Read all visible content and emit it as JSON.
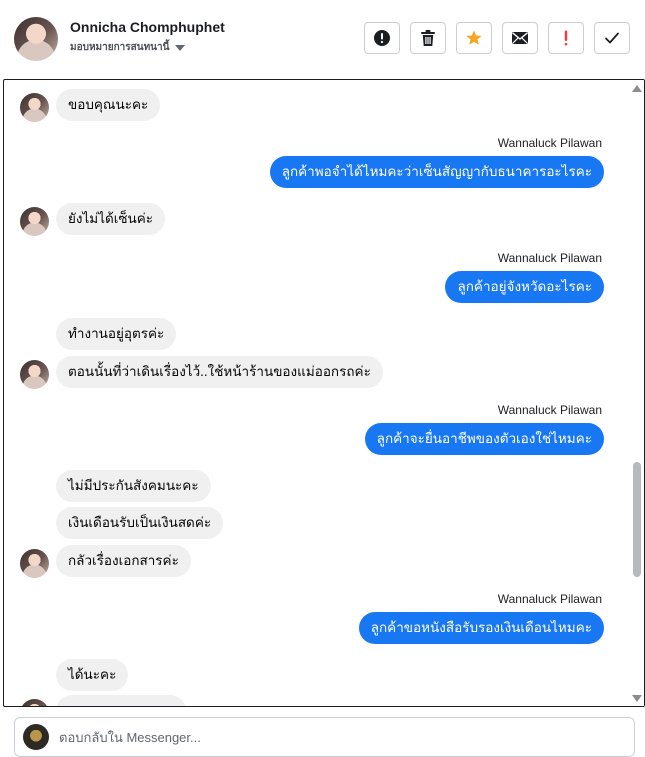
{
  "header": {
    "contact_name": "Onnicha Chomphuphet",
    "assign_label": "มอบหมายการสนทนานี้"
  },
  "toolbar": {
    "buttons": [
      {
        "name": "mark-spam",
        "icon": "exclamation-circle-icon"
      },
      {
        "name": "delete",
        "icon": "trash-icon"
      },
      {
        "name": "star",
        "icon": "star-icon",
        "color": "#f5a623"
      },
      {
        "name": "mark-unread",
        "icon": "envelope-icon"
      },
      {
        "name": "follow-up",
        "icon": "exclamation-icon",
        "color": "#fa383e"
      },
      {
        "name": "mark-done",
        "icon": "checkmark-icon"
      }
    ]
  },
  "messages": [
    {
      "type": "in",
      "text": "ขอบคุณนะคะ",
      "avatar": true
    },
    {
      "type": "out",
      "sender": "Wannaluck Pilawan",
      "text": "ลูกค้าพอจำได้ไหมคะว่าเซ็นสัญญากับธนาคารอะไรคะ"
    },
    {
      "type": "in",
      "text": "ยังไม่ได้เซ็นค่ะ",
      "avatar": true
    },
    {
      "type": "out",
      "sender": "Wannaluck Pilawan",
      "text": "ลูกค้าอยู่จังหวัดอะไรคะ"
    },
    {
      "type": "in",
      "text": "ทำงานอยู่อุตรค่ะ",
      "avatar": false
    },
    {
      "type": "in",
      "text": "ตอนนั้นที่ว่าเดินเรื่องไว้..ใช้หน้าร้านของแม่ออกรถค่ะ",
      "avatar": true
    },
    {
      "type": "out",
      "sender": "Wannaluck Pilawan",
      "text": "ลูกค้าจะยื่นอาชีพของตัวเองใช่ไหมคะ"
    },
    {
      "type": "in",
      "text": "ไม่มีประกันสังคมนะคะ",
      "avatar": false
    },
    {
      "type": "in",
      "text": "เงินเดือนรับเป็นเงินสดค่ะ",
      "avatar": false
    },
    {
      "type": "in",
      "text": "กลัวเรื่องเอกสารค่ะ",
      "avatar": true
    },
    {
      "type": "out",
      "sender": "Wannaluck Pilawan",
      "text": "ลูกค้าขอหนังสือรับรองเงินเดือนไหมคะ"
    },
    {
      "type": "in",
      "text": "ได้นะคะ",
      "avatar": false
    }
  ],
  "composer": {
    "placeholder": "ตอบกลับใน Messenger..."
  },
  "colors": {
    "outgoing_bubble": "#1877f2",
    "incoming_bubble": "#f0f0f0"
  }
}
